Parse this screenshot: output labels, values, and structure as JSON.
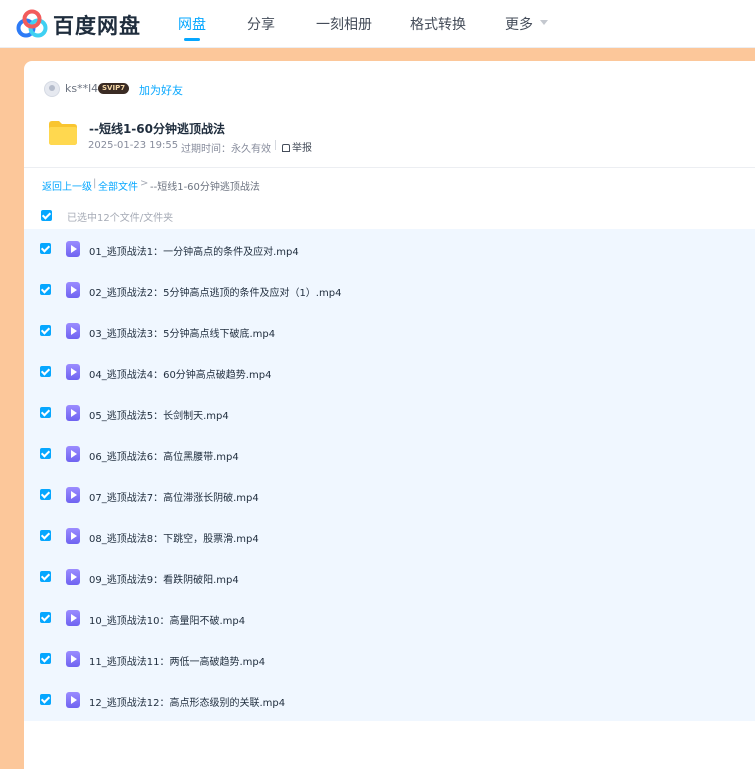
{
  "header": {
    "brand": "百度网盘",
    "nav": [
      {
        "label": "网盘"
      },
      {
        "label": "分享"
      },
      {
        "label": "一刻相册"
      },
      {
        "label": "格式转换"
      },
      {
        "label": "更多"
      }
    ]
  },
  "sharer": {
    "username": "ks**l4",
    "badge": "SVIP7",
    "add_friend": "加为好友"
  },
  "share": {
    "title": "--短线1-60分钟逃顶战法",
    "date": "2025-01-23 19:55",
    "expire": "过期时间：永久有效",
    "report": "举报"
  },
  "breadcrumb": {
    "back": "返回上一级",
    "sep1": "|",
    "all": "全部文件",
    "sep2": ">",
    "current": "--短线1-60分钟逃顶战法"
  },
  "selection": {
    "info": "已选中12个文件/文件夹"
  },
  "files": [
    {
      "name": "01_逃顶战法1：一分钟高点的条件及应对.mp4"
    },
    {
      "name": "02_逃顶战法2：5分钟高点逃顶的条件及应对（1）.mp4"
    },
    {
      "name": "03_逃顶战法3：5分钟高点线下破底.mp4"
    },
    {
      "name": "04_逃顶战法4：60分钟高点破趋势.mp4"
    },
    {
      "name": "05_逃顶战法5：长剑制天.mp4"
    },
    {
      "name": "06_逃顶战法6：高位黑腰带.mp4"
    },
    {
      "name": "07_逃顶战法7：高位滞涨长阴破.mp4"
    },
    {
      "name": "08_逃顶战法8：下跳空，股票滑.mp4"
    },
    {
      "name": "09_逃顶战法9：看跌阴破阳.mp4"
    },
    {
      "name": "10_逃顶战法10：高量阳不破.mp4"
    },
    {
      "name": "11_逃顶战法11：两低一高破趋势.mp4"
    },
    {
      "name": "12_逃顶战法12：高点形态级别的关联.mp4"
    }
  ]
}
